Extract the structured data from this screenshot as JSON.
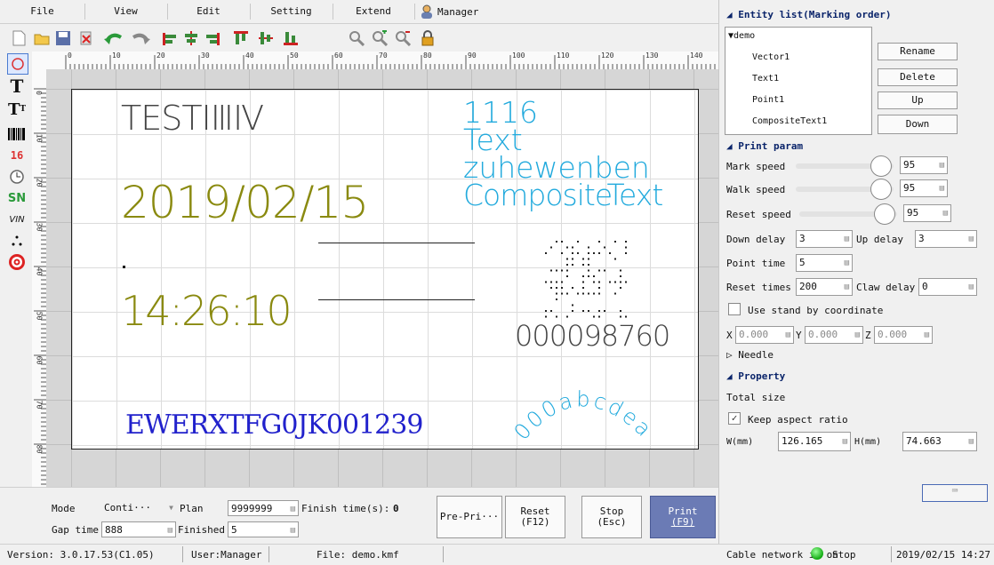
{
  "menu": {
    "items": [
      "File",
      "View",
      "Edit",
      "Setting",
      "Extend"
    ],
    "manager": "Manager"
  },
  "toolbar": {
    "icons": [
      "new-file-icon",
      "open-folder-icon",
      "save-icon",
      "delete-icon",
      "undo-icon",
      "redo-icon",
      "align-left-icon",
      "align-center-icon",
      "align-right-icon",
      "align-top-icon",
      "align-middle-icon",
      "align-bottom-icon",
      "zoom-icon",
      "zoom-in-icon",
      "zoom-out-icon",
      "lock-icon"
    ]
  },
  "lefttools": {
    "icons": [
      "ellipse-tool-icon",
      "text-tool-icon",
      "text-size-tool-icon",
      "barcode-tool-icon",
      "number-tool-icon",
      "clock-tool-icon",
      "serial-number-tool-icon",
      "vin-tool-icon",
      "dots-tool-icon",
      "target-tool-icon"
    ],
    "t16": "16",
    "sn": "SN",
    "vin": "VIN"
  },
  "ruler": {
    "h": [
      "0",
      "10",
      "20",
      "30",
      "40",
      "50",
      "60",
      "70",
      "80",
      "90",
      "100",
      "110",
      "120",
      "130",
      "140"
    ],
    "v": [
      "0",
      "10",
      "20",
      "30",
      "40",
      "50",
      "60",
      "70",
      "80"
    ]
  },
  "canvas": {
    "test": "TESTIⅢⅣ",
    "date": "2019/02/15",
    "time": "14:26:10",
    "serial": "EWERXTFG0JK001239",
    "c1": "1116",
    "c2": "Text",
    "c3": "zuhewenben",
    "c4": "CompositeText",
    "barcode_num": "000098760",
    "arc": "000abcdea",
    "colors": {
      "gray": "#444444",
      "olive": "#8a8a10",
      "blue": "#2222cc",
      "cyan": "#22aadd"
    }
  },
  "bottom": {
    "mode_label": "Mode",
    "mode_value": "Conti···",
    "plan_label": "Plan",
    "plan_value": "9999999",
    "finish_label": "Finish time(s):",
    "finish_value": "0",
    "gap_label": "Gap time",
    "gap_value": "888",
    "finished_label": "Finished",
    "finished_value": "5",
    "preprint": "Pre-Pri···",
    "reset1": "Reset",
    "reset2": "(F12)",
    "stop1": "Stop",
    "stop2": "(Esc)",
    "print1": "Print",
    "print2": "(F9)"
  },
  "status": {
    "version": "Version: 3.0.17.53(C1.05)",
    "user": "User:Manager",
    "file": "File: demo.kmf",
    "network": "Cable network is on",
    "state": "Stop",
    "datetime": "2019/02/15 14:27"
  },
  "right": {
    "entity_title": "Entity list(Marking order)",
    "tree_root": "demo",
    "entities": [
      "Vector1",
      "Text1",
      "Point1",
      "CompositeText1"
    ],
    "btn_rename": "Rename",
    "btn_delete": "Delete",
    "btn_up": "Up",
    "btn_down": "Down",
    "print_title": "Print param",
    "mark_speed_label": "Mark speed",
    "mark_speed": "95",
    "walk_speed_label": "Walk speed",
    "walk_speed": "95",
    "reset_speed_label": "Reset speed",
    "reset_speed": "95",
    "down_delay_label": "Down delay",
    "down_delay": "3",
    "up_delay_label": "Up delay",
    "up_delay": "3",
    "point_time_label": "Point time",
    "point_time": "5",
    "reset_times_label": "Reset times",
    "reset_times": "200",
    "claw_delay_label": "Claw delay",
    "claw_delay": "0",
    "standby_label": "Use stand by coordinate",
    "x_label": "X",
    "x_val": "0.000",
    "y_label": "Y",
    "y_val": "0.000",
    "z_label": "Z",
    "z_val": "0.000",
    "needle": "Needle",
    "property_title": "Property",
    "total_size": "Total size",
    "keep_aspect": "Keep aspect ratio",
    "w_label": "W(mm)",
    "w_val": "126.165",
    "h_label": "H(mm)",
    "h_val": "74.663"
  }
}
